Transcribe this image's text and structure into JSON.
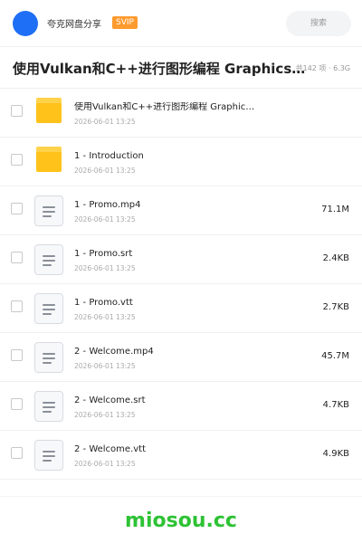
{
  "header": {
    "app_name": "夸克网盘分享",
    "badge": "SVIP",
    "search_label": "搜索",
    "avatar_color": "#1e6ff5"
  },
  "folder": {
    "title": "使用Vulkan和C++进行图形编程 Graphics Programming with Vulkan and C++",
    "meta": "共142 项 · 6.3G"
  },
  "files": [
    {
      "type": "folder",
      "icon": "folder-icon",
      "name": "使用Vulkan和C++进行图形编程 Graphics Programming with Vulkan and C++",
      "date": "2026-06-01 13:25",
      "size": ""
    },
    {
      "type": "folder",
      "icon": "folder-icon",
      "name": "1 - Introduction",
      "date": "2026-06-01 13:25",
      "size": ""
    },
    {
      "type": "file",
      "icon": "document-icon",
      "name": "1 - Promo.mp4",
      "date": "2026-06-01 13:25",
      "size": "71.1M"
    },
    {
      "type": "file",
      "icon": "document-icon",
      "name": "1 - Promo.srt",
      "date": "2026-06-01 13:25",
      "size": "2.4KB"
    },
    {
      "type": "file",
      "icon": "document-icon",
      "name": "1 - Promo.vtt",
      "date": "2026-06-01 13:25",
      "size": "2.7KB"
    },
    {
      "type": "file",
      "icon": "document-icon",
      "name": "2 - Welcome.mp4",
      "date": "2026-06-01 13:25",
      "size": "45.7M"
    },
    {
      "type": "file",
      "icon": "document-icon",
      "name": "2 - Welcome.srt",
      "date": "2026-06-01 13:25",
      "size": "4.7KB"
    },
    {
      "type": "file",
      "icon": "document-icon",
      "name": "2 - Welcome.vtt",
      "date": "2026-06-01 13:25",
      "size": "4.9KB"
    }
  ],
  "footer": {
    "watermark": "miosou.cc",
    "watermark_color": "#2ec235"
  }
}
